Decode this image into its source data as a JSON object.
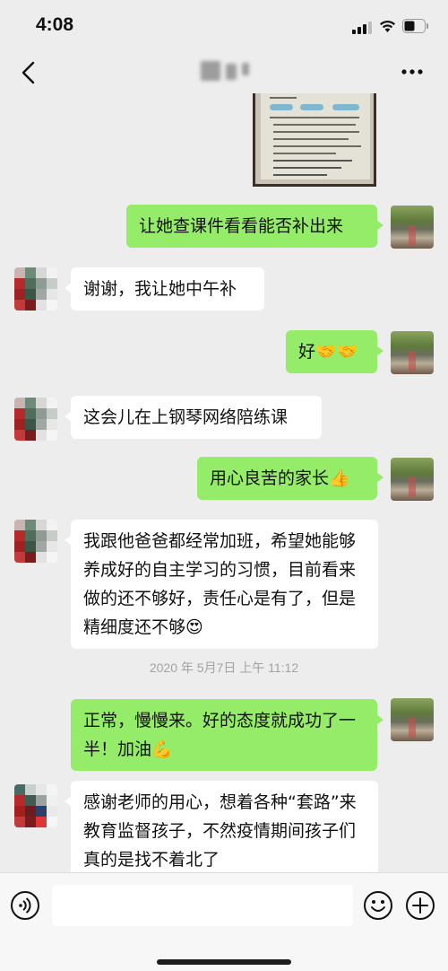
{
  "status_bar": {
    "time": "4:08"
  },
  "nav": {
    "title": ""
  },
  "messages": [
    {
      "sender": "me",
      "text": "让她查课件看看能否补出来"
    },
    {
      "sender": "other",
      "text": "谢谢，我让她中午补"
    },
    {
      "sender": "me",
      "text": "好🤝🤝"
    },
    {
      "sender": "other",
      "text": "这会儿在上钢琴网络陪练课"
    },
    {
      "sender": "me",
      "text": "用心良苦的家长👍"
    },
    {
      "sender": "other",
      "text": "我跟他爸爸都经常加班，希望她能够养成好的自主学习的习惯，目前看来做的还不够好，责任心是有了，但是精细度还不够😍"
    },
    {
      "sender": "me",
      "text": "正常，慢慢来。好的态度就成功了一半！加油💪"
    },
    {
      "sender": "other",
      "text": "感谢老师的用心，想着各种“套路”来教育监督孩子，不然疫情期间孩子们真的是找不着北了"
    }
  ],
  "timestamp": "2020 年 5月7日 上午 11:12",
  "input": {
    "placeholder": "",
    "value": ""
  },
  "colors": {
    "bubble_me": "#95ec69",
    "bubble_other": "#ffffff",
    "background": "#ededed"
  },
  "icons": [
    "back-icon",
    "more-icon",
    "voice-icon",
    "emoji-icon",
    "plus-icon"
  ]
}
